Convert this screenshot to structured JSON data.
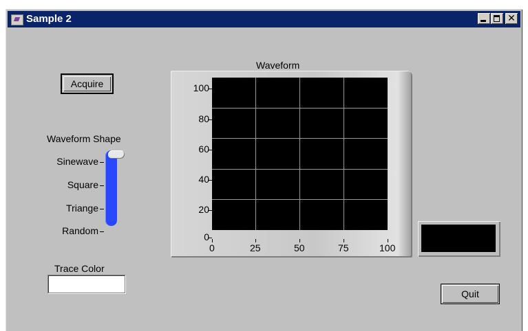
{
  "window": {
    "title": "Sample 2"
  },
  "titlebar_buttons": {
    "minimize_icon": "minimize-icon",
    "maximize_icon": "maximize-icon",
    "close_glyph": "✕"
  },
  "acquire_button": {
    "label": "Acquire"
  },
  "waveform_shape": {
    "label": "Waveform Shape",
    "options": [
      "Sinewave",
      "Square",
      "Triange",
      "Random"
    ],
    "selected": "Sinewave"
  },
  "trace_color": {
    "label": "Trace Color",
    "value": "#ffffff"
  },
  "waveform": {
    "title": "Waveform",
    "x_ticks": [
      "0",
      "25",
      "50",
      "75",
      "100"
    ],
    "y_ticks": [
      "100",
      "80",
      "60",
      "40",
      "20",
      "0"
    ]
  },
  "quit_button": {
    "label": "Quit"
  },
  "colors": {
    "window_bg": "#c0c0c0",
    "titlebar": "#0a246a",
    "slider": "#2848ff",
    "plot_bg": "#000000"
  }
}
